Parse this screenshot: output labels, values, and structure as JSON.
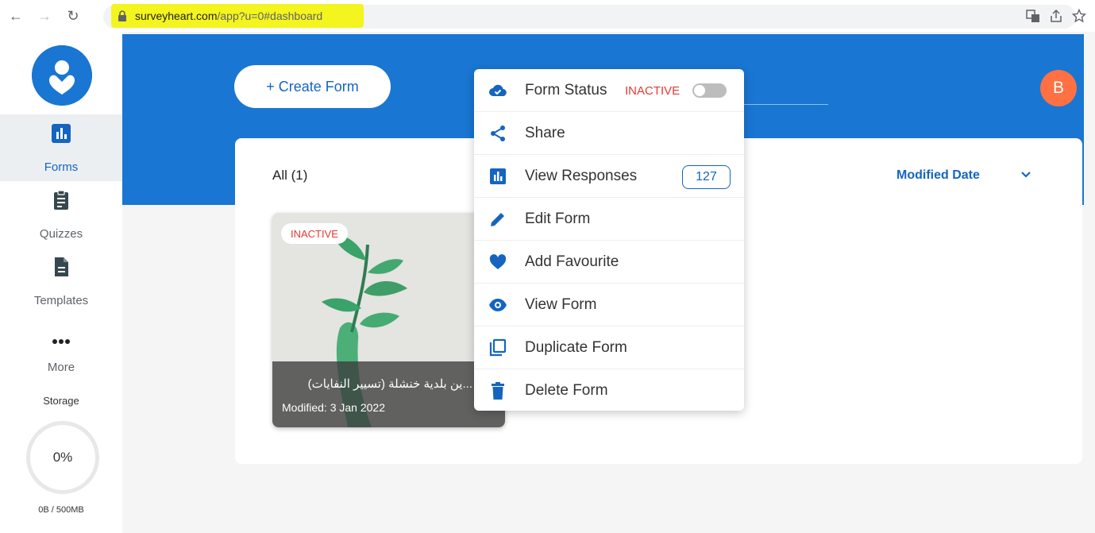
{
  "browser": {
    "url_domain": "surveyheart.com",
    "url_path": "/app?u=0#dashboard"
  },
  "sidebar": {
    "items": [
      {
        "label": "Forms",
        "icon": "bar-chart-icon"
      },
      {
        "label": "Quizzes",
        "icon": "clipboard-icon"
      },
      {
        "label": "Templates",
        "icon": "document-icon"
      },
      {
        "label": "More",
        "icon": "more-dots-icon"
      }
    ],
    "storage_label": "Storage",
    "storage_percent": "0%",
    "storage_fraction": 0,
    "storage_size": "0B / 500MB"
  },
  "header": {
    "create_label": "+ Create Form",
    "avatar_initial": "B",
    "accent_color": "#1976d2"
  },
  "list": {
    "filter_label": "All (1)",
    "sort_label": "Modified Date"
  },
  "form_card": {
    "status_badge": "INACTIVE",
    "title": "...ين بلدية خنشلة (تسيير النفايات)",
    "modified": "Modified: 3 Jan 2022"
  },
  "menu": {
    "form_status_label": "Form Status",
    "form_status_value": "INACTIVE",
    "share_label": "Share",
    "view_responses_label": "View Responses",
    "responses_count": "127",
    "edit_label": "Edit Form",
    "favourite_label": "Add Favourite",
    "view_form_label": "View Form",
    "duplicate_label": "Duplicate Form",
    "delete_label": "Delete Form"
  }
}
